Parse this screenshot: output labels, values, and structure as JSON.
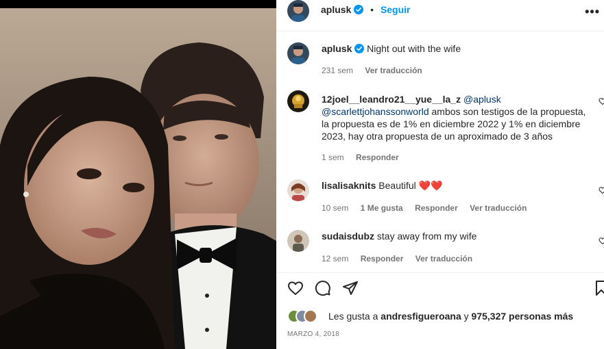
{
  "post": {
    "author": "aplusk",
    "follow_label": "Seguir",
    "more_label": "•••",
    "caption": "Night out with the wife",
    "caption_age": "231 sem",
    "caption_translate": "Ver traducción"
  },
  "comments": [
    {
      "username": "12joel__leandro21__yue__la_z",
      "mention1": "@aplusk",
      "mention2": "@scarlettjohanssonworld",
      "body": "ambos son testigos de la propuesta, la propuesta es de 1% en diciembre 2022 y 1% en diciembre 2023, hay otra propuesta de un aproximado de 3 años",
      "age": "1 sem",
      "reply_label": "Responder"
    },
    {
      "username": "lisalisaknits",
      "body": "Beautiful",
      "emoji": "❤️❤️",
      "age": "10 sem",
      "likes_label": "1 Me gusta",
      "reply_label": "Responder",
      "translate_label": "Ver traducción"
    },
    {
      "username": "sudaisdubz",
      "body": "stay away from my wife",
      "age": "12 sem",
      "reply_label": "Responder",
      "translate_label": "Ver traducción"
    }
  ],
  "likes": {
    "prefix": "Les gusta a",
    "user": "andresfigueroana",
    "connector": "y",
    "others": "975,327 personas más"
  },
  "date": "MARZO 4, 2018",
  "icons": [
    "heart-icon",
    "comment-icon",
    "share-icon",
    "bookmark-icon",
    "verified-icon",
    "more-icon"
  ],
  "colors": {
    "link": "#0095f6",
    "verified": "#0095f6",
    "secondary_text": "#737373",
    "mention": "#00376b"
  }
}
